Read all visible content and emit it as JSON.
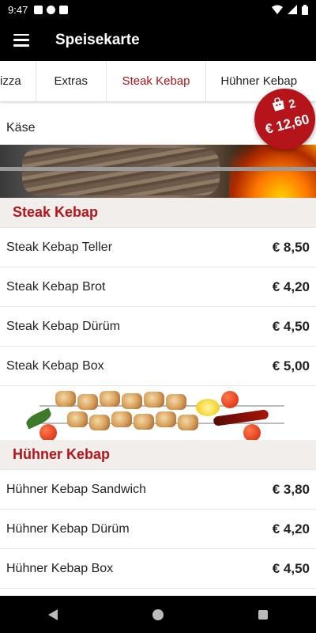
{
  "status_bar": {
    "time": "9:47",
    "left_icons": [
      "message-icon",
      "app-notification-icon",
      "sd-card-icon"
    ],
    "right_icons": [
      "wifi-icon",
      "signal-icon",
      "battery-icon"
    ]
  },
  "app_bar": {
    "title": "Speisekarte",
    "menu_icon": "hamburger-menu-icon"
  },
  "tabs": {
    "items": [
      {
        "label": "izza",
        "selected": false
      },
      {
        "label": "Extras",
        "selected": false
      },
      {
        "label": "Steak Kebap",
        "selected": true
      },
      {
        "label": "Hühner Kebap",
        "selected": false
      }
    ],
    "selected_color": "#b4141a"
  },
  "cart": {
    "count": "2",
    "total": "€ 12,60",
    "icon": "shopping-bag-icon",
    "color": "#b4141a"
  },
  "top_item": {
    "name": "Käse"
  },
  "sections": [
    {
      "title": "Steak Kebap",
      "items": [
        {
          "name": "Steak Kebap Teller",
          "price": "€ 8,50"
        },
        {
          "name": "Steak Kebap Brot",
          "price": "€ 4,20"
        },
        {
          "name": "Steak Kebap Dürüm",
          "price": "€ 4,50"
        },
        {
          "name": "Steak Kebap Box",
          "price": "€ 5,00"
        }
      ]
    },
    {
      "title": "Hühner Kebap",
      "items": [
        {
          "name": "Hühner Kebap Sandwich",
          "price": "€ 3,80"
        },
        {
          "name": "Hühner Kebap Dürüm",
          "price": "€ 4,20"
        },
        {
          "name": "Hühner Kebap Box",
          "price": "€ 4,50"
        }
      ]
    }
  ],
  "nav_bar": {
    "icons": [
      "back-icon",
      "home-icon",
      "recent-apps-icon"
    ]
  }
}
